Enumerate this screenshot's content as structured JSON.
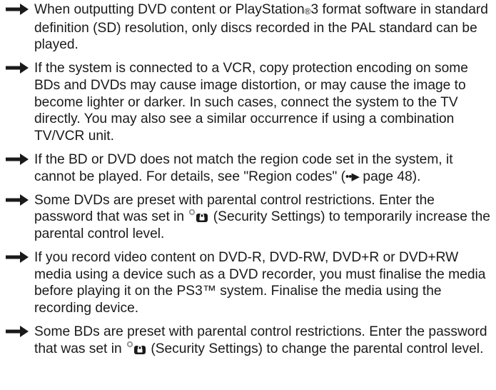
{
  "colors": {
    "text": "#1a1a1a",
    "arrow": "#1a1a1a"
  },
  "bullets": [
    {
      "icon": "right-arrow-icon",
      "pre": "When outputting DVD content or PlayStation",
      "reg": "®",
      "post": "3 format software in standard definition (SD) resolution, only discs recorded in the PAL standard can be played."
    },
    {
      "icon": "right-arrow-icon",
      "text": "If the system is connected to a VCR, copy protection encoding on some BDs and DVDs may cause image distortion, or may cause the image to become lighter or darker. In such cases, connect the system to the TV directly. You may also see a similar occurrence if using a combination TV/VCR unit."
    },
    {
      "icon": "right-arrow-icon",
      "pre": "If the BD or DVD does not match the region code set in the system, it cannot be played. For details, see \"Region codes\" (",
      "ref_arrow": "••▶",
      "post": " page 48)."
    },
    {
      "icon": "right-arrow-icon",
      "pre": "Some DVDs are preset with parental control restrictions. Enter the password that was set in ",
      "security_icon": "security-settings-icon",
      "post": " (Security Settings) to temporarily increase the parental control level."
    },
    {
      "icon": "right-arrow-icon",
      "text": "If you record video content on DVD-R, DVD-RW, DVD+R or DVD+RW media using a device such as a DVD recorder, you must finalise the media before playing it on the PS3™ system. Finalise the media using the recording device."
    },
    {
      "icon": "right-arrow-icon",
      "pre": "Some BDs are preset with parental control restrictions. Enter the password that was set in ",
      "security_icon": "security-settings-icon",
      "post": " (Security Settings) to change the parental control level."
    }
  ]
}
